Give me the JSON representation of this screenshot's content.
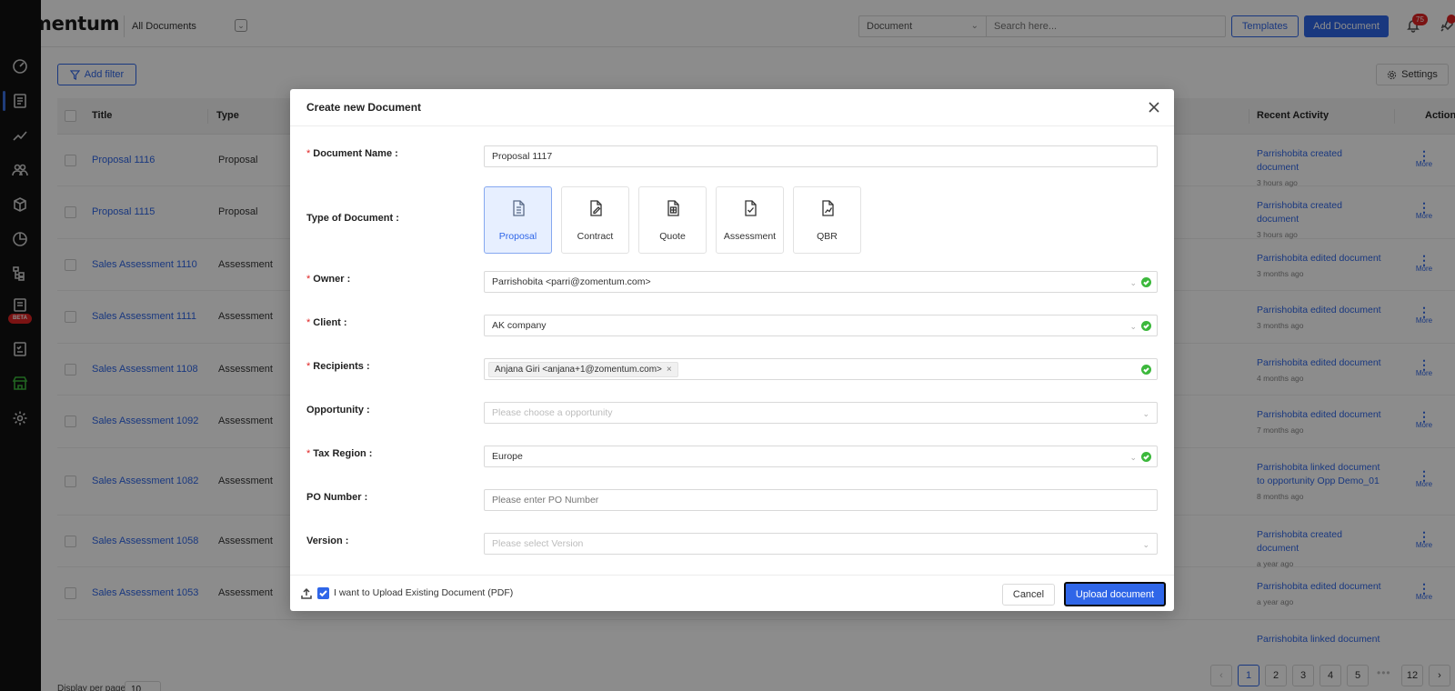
{
  "header": {
    "logo": "zomentum",
    "view_select": "All Documents",
    "search_type": "Document",
    "search_placeholder": "Search here...",
    "templates_label": "Templates",
    "add_document_label": "Add Document",
    "notification_count": "75"
  },
  "sidebar": {
    "beta_label": "BETA"
  },
  "toolbar": {
    "add_filter_label": "Add filter",
    "settings_label": "Settings"
  },
  "table": {
    "headers": {
      "title": "Title",
      "type": "Type",
      "recent_activity": "Recent Activity",
      "action": "Action"
    },
    "more_label": "More",
    "rows": [
      {
        "title": "Proposal 1116",
        "type": "Proposal",
        "activity": "Parrishobita created document",
        "time": "3 hours ago"
      },
      {
        "title": "Proposal 1115",
        "type": "Proposal",
        "activity": "Parrishobita created document",
        "time": "3 hours ago"
      },
      {
        "title": "Sales Assessment 1110",
        "type": "Assessment",
        "activity": "Parrishobita edited document",
        "time": "3 months ago"
      },
      {
        "title": "Sales Assessment 1111",
        "type": "Assessment",
        "activity": "Parrishobita edited document",
        "time": "3 months ago"
      },
      {
        "title": "Sales Assessment 1108",
        "type": "Assessment",
        "activity": "Parrishobita edited document",
        "time": "4 months ago"
      },
      {
        "title": "Sales Assessment 1092",
        "type": "Assessment",
        "activity": "Parrishobita edited document",
        "time": "7 months ago"
      },
      {
        "title": "Sales Assessment 1082",
        "type": "Assessment",
        "activity": "Parrishobita linked document to opportunity Opp Demo_01",
        "time": "8 months ago"
      },
      {
        "title": "Sales Assessment 1058",
        "type": "Assessment",
        "activity": "Parrishobita created document",
        "time": "a year ago"
      },
      {
        "title": "Sales Assessment 1053",
        "type": "Assessment",
        "activity": "Parrishobita edited document",
        "time": "a year ago"
      },
      {
        "title": "",
        "type": "",
        "activity": "Parrishobita linked document",
        "time": ""
      }
    ]
  },
  "pagination": {
    "pages": [
      "1",
      "2",
      "3",
      "4",
      "5",
      "12"
    ],
    "prev": "‹",
    "next": "›",
    "ellipsis": "•••",
    "current": "1",
    "display_label": "Display per page",
    "per_page": "10"
  },
  "modal": {
    "title": "Create new Document",
    "fields": {
      "document_name_label": "Document Name :",
      "document_name_value": "Proposal 1117",
      "type_label": "Type of Document :",
      "owner_label": "Owner :",
      "owner_value": "Parrishobita <parri@zomentum.com>",
      "client_label": "Client :",
      "client_value": "AK company",
      "recipients_label": "Recipients :",
      "recipient_tag": "Anjana Giri <anjana+1@zomentum.com>",
      "opportunity_label": "Opportunity :",
      "opportunity_placeholder": "Please choose a opportunity",
      "tax_region_label": "Tax Region :",
      "tax_region_value": "Europe",
      "po_number_label": "PO Number :",
      "po_number_placeholder": "Please enter PO Number",
      "version_label": "Version :",
      "version_placeholder": "Please select Version"
    },
    "doc_types": [
      {
        "label": "Proposal",
        "icon": "file-text-icon",
        "selected": true
      },
      {
        "label": "Contract",
        "icon": "file-edit-icon",
        "selected": false
      },
      {
        "label": "Quote",
        "icon": "file-table-icon",
        "selected": false
      },
      {
        "label": "Assessment",
        "icon": "file-check-icon",
        "selected": false
      },
      {
        "label": "QBR",
        "icon": "file-chart-icon",
        "selected": false
      }
    ],
    "footer": {
      "upload_checkbox_label": "I want to Upload Existing Document (PDF)",
      "upload_checked": true,
      "cancel_label": "Cancel",
      "submit_label": "Upload document"
    }
  },
  "colors": {
    "accent": "#2f66e8",
    "required": "#e02424",
    "valid": "#3cb83c",
    "sidebar": "#111111"
  }
}
